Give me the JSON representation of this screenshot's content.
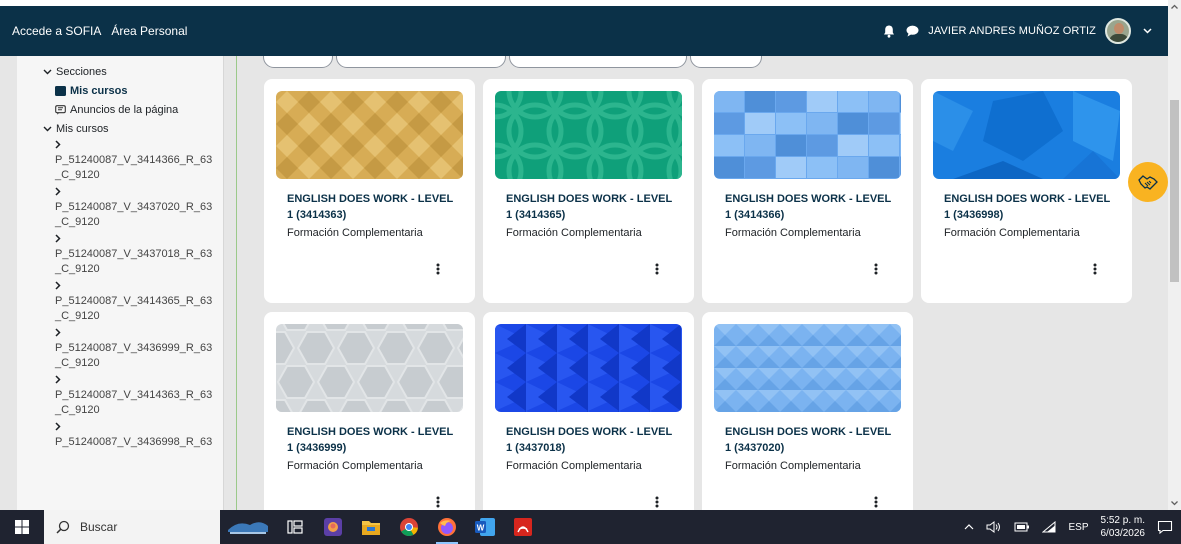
{
  "navbar": {
    "links": [
      "Accede a SOFIA",
      "Área Personal"
    ],
    "user_name": "JAVIER ANDRES MUÑOZ ORTIZ",
    "icons": [
      "bell-icon",
      "chat-icon",
      "chevron-down-icon"
    ]
  },
  "sidebar": {
    "sections_label": "Secciones",
    "mis_cursos_active": "Mis cursos",
    "anuncios": "Anuncios de la página",
    "mis_cursos_group": "Mis cursos",
    "courses": [
      {
        "line1": "P_51240087_V_3414366_R_63",
        "line2": "_C_9120"
      },
      {
        "line1": "P_51240087_V_3437020_R_63",
        "line2": "_C_9120"
      },
      {
        "line1": "P_51240087_V_3437018_R_63",
        "line2": "_C_9120"
      },
      {
        "line1": "P_51240087_V_3414365_R_63",
        "line2": "_C_9120"
      },
      {
        "line1": "P_51240087_V_3436999_R_63",
        "line2": "_C_9120"
      },
      {
        "line1": "P_51240087_V_3414363_R_63",
        "line2": "_C_9120"
      },
      {
        "line1": "P_51240087_V_3436998_R_63",
        "line2": ""
      }
    ]
  },
  "cards": [
    {
      "title_line1": "ENGLISH DOES WORK - LEVEL",
      "title_line2": "1 (3414363)",
      "category": "Formación Complementaria",
      "pattern": "gold-diamonds"
    },
    {
      "title_line1": "ENGLISH DOES WORK - LEVEL",
      "title_line2": "1 (3414365)",
      "category": "Formación Complementaria",
      "pattern": "green-circles"
    },
    {
      "title_line1": "ENGLISH DOES WORK - LEVEL",
      "title_line2": "1 (3414366)",
      "category": "Formación Complementaria",
      "pattern": "blue-squares"
    },
    {
      "title_line1": "ENGLISH DOES WORK - LEVEL",
      "title_line2": "1 (3436998)",
      "category": "Formación Complementaria",
      "pattern": "blue-polygons"
    },
    {
      "title_line1": "ENGLISH DOES WORK - LEVEL",
      "title_line2": "1 (3436999)",
      "category": "Formación Complementaria",
      "pattern": "gray-hexagons"
    },
    {
      "title_line1": "ENGLISH DOES WORK - LEVEL",
      "title_line2": "1 (3437018)",
      "category": "Formación Complementaria",
      "pattern": "blue-triangles"
    },
    {
      "title_line1": "ENGLISH DOES WORK - LEVEL",
      "title_line2": "1 (3437020)",
      "category": "Formación Complementaria",
      "pattern": "light-blue-triangles"
    }
  ],
  "taskbar": {
    "search_placeholder": "Buscar",
    "language": "ESP",
    "time": "5:52 p. m.",
    "date": "6/03/2026",
    "apps": [
      "start-menu-icon",
      "task-view-icon",
      "photo-app-icon",
      "file-explorer-icon",
      "chrome-icon",
      "firefox-icon",
      "word-icon",
      "acrobat-icon"
    ]
  },
  "colors": {
    "navbar": "#0b3148",
    "accent_text": "#0b3148",
    "help_button": "#f9b321"
  }
}
